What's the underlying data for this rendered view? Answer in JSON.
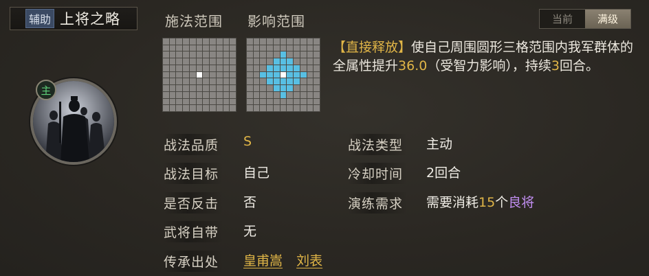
{
  "header": {
    "type_tag": "辅助",
    "skill_name": "上将之略"
  },
  "avatar": {
    "badge": "主"
  },
  "range": {
    "cast_label": "施法范围",
    "effect_label": "影响范围"
  },
  "toggle": {
    "current": "当前",
    "max": "满级",
    "selected": "满级"
  },
  "description": {
    "tag": "【直接释放】",
    "text1": "使自己周围圆形三格范围内我军群体的全属性提升",
    "value1": "36.0",
    "text2": "（受智力影响），持续",
    "value2": "3",
    "text3": "回合。"
  },
  "attributes": {
    "quality": {
      "label": "战法品质",
      "value": "S"
    },
    "target": {
      "label": "战法目标",
      "value": "自己"
    },
    "counter": {
      "label": "是否反击",
      "value": "否"
    },
    "innate": {
      "label": "武将自带",
      "value": "无"
    },
    "source": {
      "label": "传承出处",
      "values": [
        "皇甫嵩",
        "刘表"
      ]
    },
    "type": {
      "label": "战法类型",
      "value": "主动"
    },
    "cooldown": {
      "label": "冷却时间",
      "value": "2回合"
    },
    "training": {
      "label": "演练需求",
      "text": "需要消耗",
      "count": "15",
      "unit": "个",
      "item": "良将"
    }
  },
  "colors": {
    "gold": "#e0b547",
    "blue": "#58bfe3",
    "purple": "#c08df0",
    "green": "#5fd27a"
  }
}
